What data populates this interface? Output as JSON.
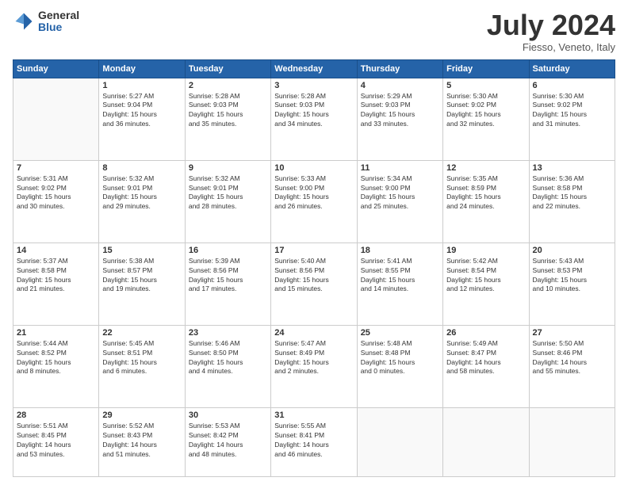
{
  "header": {
    "logo_general": "General",
    "logo_blue": "Blue",
    "title": "July 2024",
    "location": "Fiesso, Veneto, Italy"
  },
  "weekdays": [
    "Sunday",
    "Monday",
    "Tuesday",
    "Wednesday",
    "Thursday",
    "Friday",
    "Saturday"
  ],
  "weeks": [
    [
      {
        "day": "",
        "info": ""
      },
      {
        "day": "1",
        "info": "Sunrise: 5:27 AM\nSunset: 9:04 PM\nDaylight: 15 hours\nand 36 minutes."
      },
      {
        "day": "2",
        "info": "Sunrise: 5:28 AM\nSunset: 9:03 PM\nDaylight: 15 hours\nand 35 minutes."
      },
      {
        "day": "3",
        "info": "Sunrise: 5:28 AM\nSunset: 9:03 PM\nDaylight: 15 hours\nand 34 minutes."
      },
      {
        "day": "4",
        "info": "Sunrise: 5:29 AM\nSunset: 9:03 PM\nDaylight: 15 hours\nand 33 minutes."
      },
      {
        "day": "5",
        "info": "Sunrise: 5:30 AM\nSunset: 9:02 PM\nDaylight: 15 hours\nand 32 minutes."
      },
      {
        "day": "6",
        "info": "Sunrise: 5:30 AM\nSunset: 9:02 PM\nDaylight: 15 hours\nand 31 minutes."
      }
    ],
    [
      {
        "day": "7",
        "info": "Sunrise: 5:31 AM\nSunset: 9:02 PM\nDaylight: 15 hours\nand 30 minutes."
      },
      {
        "day": "8",
        "info": "Sunrise: 5:32 AM\nSunset: 9:01 PM\nDaylight: 15 hours\nand 29 minutes."
      },
      {
        "day": "9",
        "info": "Sunrise: 5:32 AM\nSunset: 9:01 PM\nDaylight: 15 hours\nand 28 minutes."
      },
      {
        "day": "10",
        "info": "Sunrise: 5:33 AM\nSunset: 9:00 PM\nDaylight: 15 hours\nand 26 minutes."
      },
      {
        "day": "11",
        "info": "Sunrise: 5:34 AM\nSunset: 9:00 PM\nDaylight: 15 hours\nand 25 minutes."
      },
      {
        "day": "12",
        "info": "Sunrise: 5:35 AM\nSunset: 8:59 PM\nDaylight: 15 hours\nand 24 minutes."
      },
      {
        "day": "13",
        "info": "Sunrise: 5:36 AM\nSunset: 8:58 PM\nDaylight: 15 hours\nand 22 minutes."
      }
    ],
    [
      {
        "day": "14",
        "info": "Sunrise: 5:37 AM\nSunset: 8:58 PM\nDaylight: 15 hours\nand 21 minutes."
      },
      {
        "day": "15",
        "info": "Sunrise: 5:38 AM\nSunset: 8:57 PM\nDaylight: 15 hours\nand 19 minutes."
      },
      {
        "day": "16",
        "info": "Sunrise: 5:39 AM\nSunset: 8:56 PM\nDaylight: 15 hours\nand 17 minutes."
      },
      {
        "day": "17",
        "info": "Sunrise: 5:40 AM\nSunset: 8:56 PM\nDaylight: 15 hours\nand 15 minutes."
      },
      {
        "day": "18",
        "info": "Sunrise: 5:41 AM\nSunset: 8:55 PM\nDaylight: 15 hours\nand 14 minutes."
      },
      {
        "day": "19",
        "info": "Sunrise: 5:42 AM\nSunset: 8:54 PM\nDaylight: 15 hours\nand 12 minutes."
      },
      {
        "day": "20",
        "info": "Sunrise: 5:43 AM\nSunset: 8:53 PM\nDaylight: 15 hours\nand 10 minutes."
      }
    ],
    [
      {
        "day": "21",
        "info": "Sunrise: 5:44 AM\nSunset: 8:52 PM\nDaylight: 15 hours\nand 8 minutes."
      },
      {
        "day": "22",
        "info": "Sunrise: 5:45 AM\nSunset: 8:51 PM\nDaylight: 15 hours\nand 6 minutes."
      },
      {
        "day": "23",
        "info": "Sunrise: 5:46 AM\nSunset: 8:50 PM\nDaylight: 15 hours\nand 4 minutes."
      },
      {
        "day": "24",
        "info": "Sunrise: 5:47 AM\nSunset: 8:49 PM\nDaylight: 15 hours\nand 2 minutes."
      },
      {
        "day": "25",
        "info": "Sunrise: 5:48 AM\nSunset: 8:48 PM\nDaylight: 15 hours\nand 0 minutes."
      },
      {
        "day": "26",
        "info": "Sunrise: 5:49 AM\nSunset: 8:47 PM\nDaylight: 14 hours\nand 58 minutes."
      },
      {
        "day": "27",
        "info": "Sunrise: 5:50 AM\nSunset: 8:46 PM\nDaylight: 14 hours\nand 55 minutes."
      }
    ],
    [
      {
        "day": "28",
        "info": "Sunrise: 5:51 AM\nSunset: 8:45 PM\nDaylight: 14 hours\nand 53 minutes."
      },
      {
        "day": "29",
        "info": "Sunrise: 5:52 AM\nSunset: 8:43 PM\nDaylight: 14 hours\nand 51 minutes."
      },
      {
        "day": "30",
        "info": "Sunrise: 5:53 AM\nSunset: 8:42 PM\nDaylight: 14 hours\nand 48 minutes."
      },
      {
        "day": "31",
        "info": "Sunrise: 5:55 AM\nSunset: 8:41 PM\nDaylight: 14 hours\nand 46 minutes."
      },
      {
        "day": "",
        "info": ""
      },
      {
        "day": "",
        "info": ""
      },
      {
        "day": "",
        "info": ""
      }
    ]
  ]
}
